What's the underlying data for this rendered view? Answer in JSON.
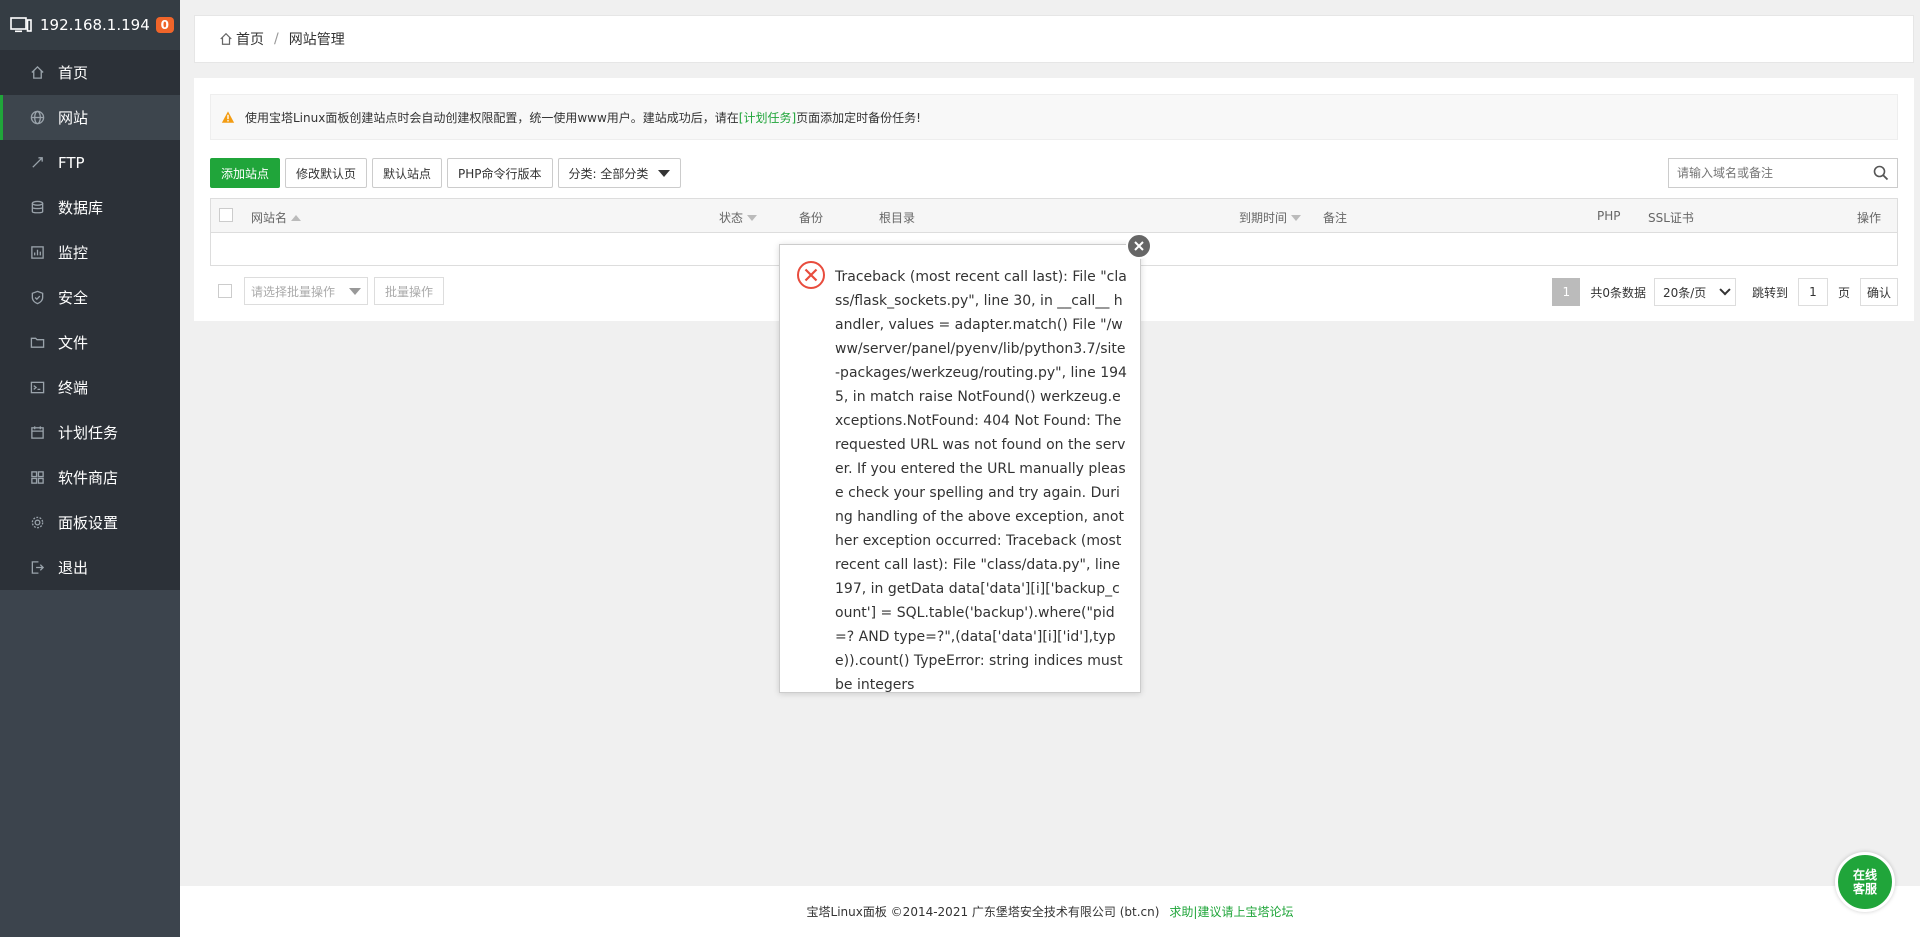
{
  "sidebar": {
    "ip": "192.168.1.194",
    "badge": "0",
    "items": [
      {
        "label": "首页",
        "icon": "home-icon"
      },
      {
        "label": "网站",
        "icon": "globe-icon"
      },
      {
        "label": "FTP",
        "icon": "ftp-icon"
      },
      {
        "label": "数据库",
        "icon": "database-icon"
      },
      {
        "label": "监控",
        "icon": "monitor-icon"
      },
      {
        "label": "安全",
        "icon": "shield-icon"
      },
      {
        "label": "文件",
        "icon": "folder-icon"
      },
      {
        "label": "终端",
        "icon": "terminal-icon"
      },
      {
        "label": "计划任务",
        "icon": "calendar-icon"
      },
      {
        "label": "软件商店",
        "icon": "apps-icon"
      },
      {
        "label": "面板设置",
        "icon": "gear-icon"
      },
      {
        "label": "退出",
        "icon": "logout-icon"
      }
    ]
  },
  "breadcrumb": {
    "home": "首页",
    "sep": "/",
    "current": "网站管理"
  },
  "notice": {
    "text_before": "使用宝塔Linux面板创建站点时会自动创建权限配置，统一使用www用户。建站成功后，请在",
    "link": "[计划任务]",
    "text_after": "页面添加定时备份任务!"
  },
  "toolbar": {
    "add_site": "添加站点",
    "edit_default_page": "修改默认页",
    "default_site": "默认站点",
    "php_cli": "PHP命令行版本",
    "category": "分类: 全部分类"
  },
  "search": {
    "placeholder": "请输入域名或备注"
  },
  "table": {
    "headers": {
      "name": "网站名",
      "status": "状态",
      "backup": "备份",
      "root": "根目录",
      "expire": "到期时间",
      "remark": "备注",
      "php": "PHP",
      "ssl": "SSL证书",
      "actions": "操作"
    }
  },
  "batch": {
    "select_placeholder": "请选择批量操作",
    "button": "批量操作"
  },
  "pager": {
    "current": "1",
    "total": "共0条数据",
    "per_page": "20条/页",
    "goto_label": "跳转到",
    "goto_value": "1",
    "page_unit": "页",
    "confirm": "确认"
  },
  "footer": {
    "copyright": "宝塔Linux面板 ©2014-2021 广东堡塔安全技术有限公司 (bt.cn)",
    "link": "求助|建议请上宝塔论坛"
  },
  "support": {
    "line1": "在线",
    "line2": "客服"
  },
  "dialog": {
    "message": "Traceback (most recent call last): File \"class/flask_sockets.py\", line 30, in __call__ handler, values = adapter.match() File \"/www/server/panel/pyenv/lib/python3.7/site-packages/werkzeug/routing.py\", line 1945, in match raise NotFound() werkzeug.exceptions.NotFound: 404 Not Found: The requested URL was not found on the server. If you entered the URL manually please check your spelling and try again. During handling of the above exception, another exception occurred: Traceback (most recent call last): File \"class/data.py\", line 197, in getData data['data'][i]['backup_count'] = SQL.table('backup').where(\"pid=? AND type=?\",(data['data'][i]['id'],type)).count() TypeError: string indices must be integers"
  },
  "colors": {
    "accent": "#20a53a",
    "sidebar": "#3c444d",
    "badge": "#f0652a",
    "error": "#e84c3d"
  }
}
